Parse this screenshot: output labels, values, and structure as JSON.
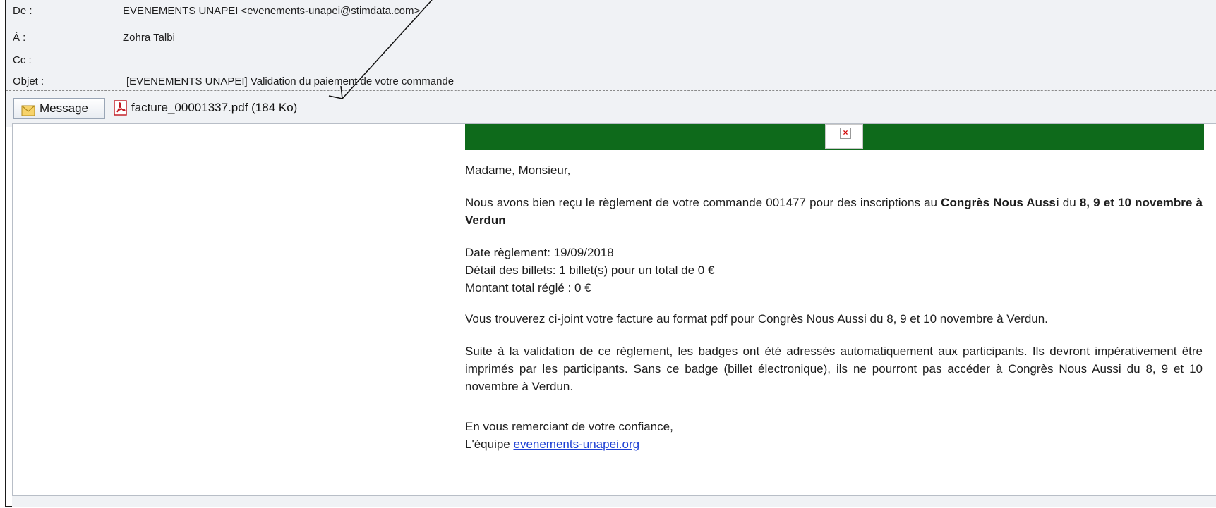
{
  "header": {
    "fields": [
      {
        "label": "De :",
        "value": "EVENEMENTS UNAPEI <evenements-unapei@stimdata.com>"
      },
      {
        "label": "À :",
        "value": "Zohra Talbi"
      },
      {
        "label": "Cc :",
        "value": ""
      },
      {
        "label": "Objet :",
        "value": "[EVENEMENTS UNAPEI] Validation du paiement de votre commande"
      }
    ]
  },
  "tabs": {
    "message_label": "Message",
    "attachment_label": "facture_00001337.pdf (184 Ko)"
  },
  "body": {
    "greeting": "Madame, Monsieur,",
    "p1_a": "Nous avons bien reçu le règlement de votre commande 001477 pour des inscriptions au ",
    "p1_b": "Congrès Nous Aussi",
    "p1_c": " du ",
    "p1_d": "8, 9 et 10 novembre à Verdun",
    "date_line": "Date règlement: 19/09/2018",
    "detail_line": "Détail des billets: 1 billet(s) pour un total de 0 €",
    "total_line": "Montant total réglé : 0 €",
    "p3": "Vous trouverez ci-joint votre facture au format pdf pour Congrès Nous Aussi du 8, 9 et 10 novembre à Verdun.",
    "p4": "Suite à la validation de ce règlement, les badges ont été adressés automatiquement aux participants. Ils devront impérativement être imprimés par les participants. Sans ce badge (billet électronique), ils ne pourront pas accéder à Congrès Nous Aussi du 8, 9 et 10 novembre à Verdun.",
    "closing": "En vous remerciant de votre confiance,",
    "signature_prefix": "L'équipe ",
    "signature_link": "evenements-unapei.org"
  },
  "colors": {
    "banner": "#0e6a1b",
    "link": "#1c3fd4",
    "header_bg": "#f0f2f5"
  },
  "icons": [
    "envelope-icon",
    "pdf-icon",
    "broken-image-icon",
    "annotation-arrow"
  ]
}
